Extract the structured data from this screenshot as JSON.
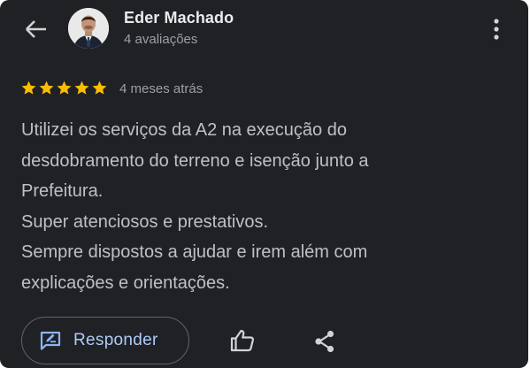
{
  "header": {
    "author_name": "Eder Machado",
    "review_count": "4 avaliações",
    "icons": {
      "back": "arrow-left-icon",
      "avatar": "avatar",
      "more": "more-vert-icon"
    }
  },
  "review": {
    "rating": 5,
    "rating_max": 5,
    "time_ago": "4 meses atrás",
    "text_lines": [
      "Utilizei os serviços da A2 na execução do",
      "desdobramento do terreno e isenção junto a",
      "Prefeitura.",
      "Super atenciosos e prestativos.",
      "Sempre dispostos a ajudar e irem além com",
      "explicações e orientações."
    ]
  },
  "actions": {
    "reply_label": "Responder",
    "icons": {
      "reply": "reply-icon",
      "like": "thumb-up-icon",
      "share": "share-icon"
    }
  },
  "colors": {
    "background": "#202124",
    "star": "#fbbc04",
    "primary_text": "#e8eaed",
    "secondary_text": "#9aa0a6",
    "body_text": "#bdc1c6",
    "accent": "#8ab4f8",
    "accent_text": "#aecbfa",
    "icon": "#d2d3d6"
  }
}
